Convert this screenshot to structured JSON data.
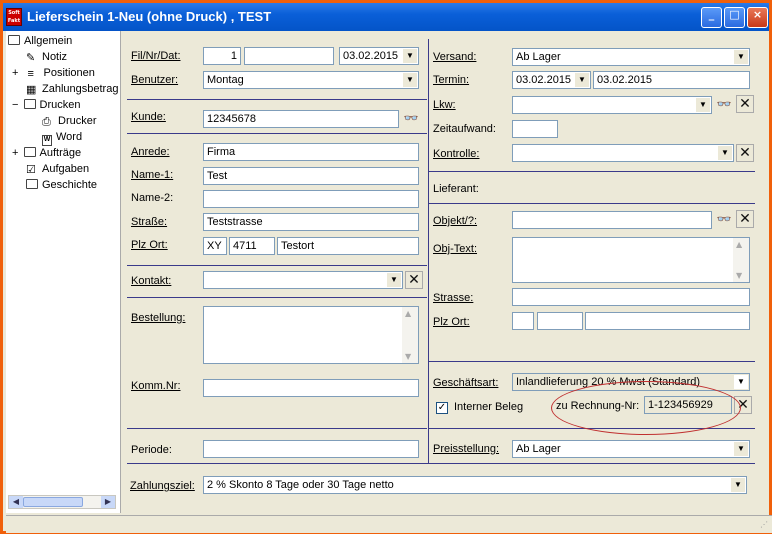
{
  "window": {
    "title": "Lieferschein 1-Neu (ohne Druck) , TEST",
    "icon_text": "Soft Fakt"
  },
  "tree": {
    "items": [
      {
        "label": "Allgemein",
        "icon": "folder-open-icon",
        "expander": ""
      },
      {
        "label": "Notiz",
        "icon": "note-icon",
        "expander": ""
      },
      {
        "label": "Positionen",
        "icon": "list-icon",
        "expander": "+"
      },
      {
        "label": "Zahlungsbetrag",
        "icon": "calculator-icon",
        "expander": ""
      },
      {
        "label": "Drucken",
        "icon": "folder-open-icon",
        "expander": "−"
      },
      {
        "label": "Drucker",
        "icon": "printer-icon",
        "expander": ""
      },
      {
        "label": "Word",
        "icon": "word-icon",
        "expander": ""
      },
      {
        "label": "Aufträge",
        "icon": "folder-icon",
        "expander": "+"
      },
      {
        "label": "Aufgaben",
        "icon": "checklist-icon",
        "expander": ""
      },
      {
        "label": "Geschichte",
        "icon": "folder-icon",
        "expander": ""
      }
    ]
  },
  "left": {
    "fil_label": "Fil/Nr/Dat:",
    "fil_value": "1",
    "nr_value": "",
    "dat_value": "03.02.2015",
    "benutzer_label": "Benutzer:",
    "benutzer_value": "Montag",
    "kunde_label": "Kunde:",
    "kunde_value": "12345678",
    "anrede_label": "Anrede:",
    "anrede_value": "Firma",
    "name1_label": "Name-1:",
    "name1_value": "Test",
    "name2_label": "Name-2:",
    "name2_value": "",
    "strasse_label": "Straße:",
    "strasse_value": "Teststrasse",
    "plzort_label": "Plz Ort:",
    "land_value": "XY",
    "plz_value": "4711",
    "ort_value": "Testort",
    "kontakt_label": "Kontakt:",
    "kontakt_value": "",
    "bestellung_label": "Bestellung:",
    "bestellung_value": "",
    "kommnr_label": "Komm.Nr:",
    "kommnr_value": "",
    "periode_label": "Periode:",
    "periode_value": ""
  },
  "right": {
    "versand_label": "Versand:",
    "versand_value": "Ab Lager",
    "termin_label": "Termin:",
    "termin_from": "03.02.2015",
    "termin_to": "03.02.2015",
    "lkw_label": "Lkw:",
    "lkw_value": "",
    "zeitaufwand_label": "Zeitaufwand:",
    "zeitaufwand_value": "",
    "kontrolle_label": "Kontrolle:",
    "kontrolle_value": "",
    "lieferant_label": "Lieferant:",
    "objekt_label": "Objekt/?:",
    "objekt_value": "",
    "objtext_label": "Obj-Text:",
    "objtext_value": "",
    "strasse_label": "Strasse:",
    "strasse_value": "",
    "plzort_label": "Plz Ort:",
    "geschaeftsart_label": "Geschäftsart:",
    "geschaeftsart_value": "Inlandlieferung 20 % Mwst  (Standard)",
    "interner_beleg_label": "Interner Beleg",
    "interner_beleg_checked": "✓",
    "zu_rechnung_label": "zu Rechnung-Nr:",
    "zu_rechnung_value": "1-123456929",
    "preisstellung_label": "Preisstellung:",
    "preisstellung_value": "Ab Lager"
  },
  "bottom": {
    "zahlungsziel_label": "Zahlungsziel:",
    "zahlungsziel_value": "2 % Skonto 8 Tage oder 30 Tage netto"
  }
}
